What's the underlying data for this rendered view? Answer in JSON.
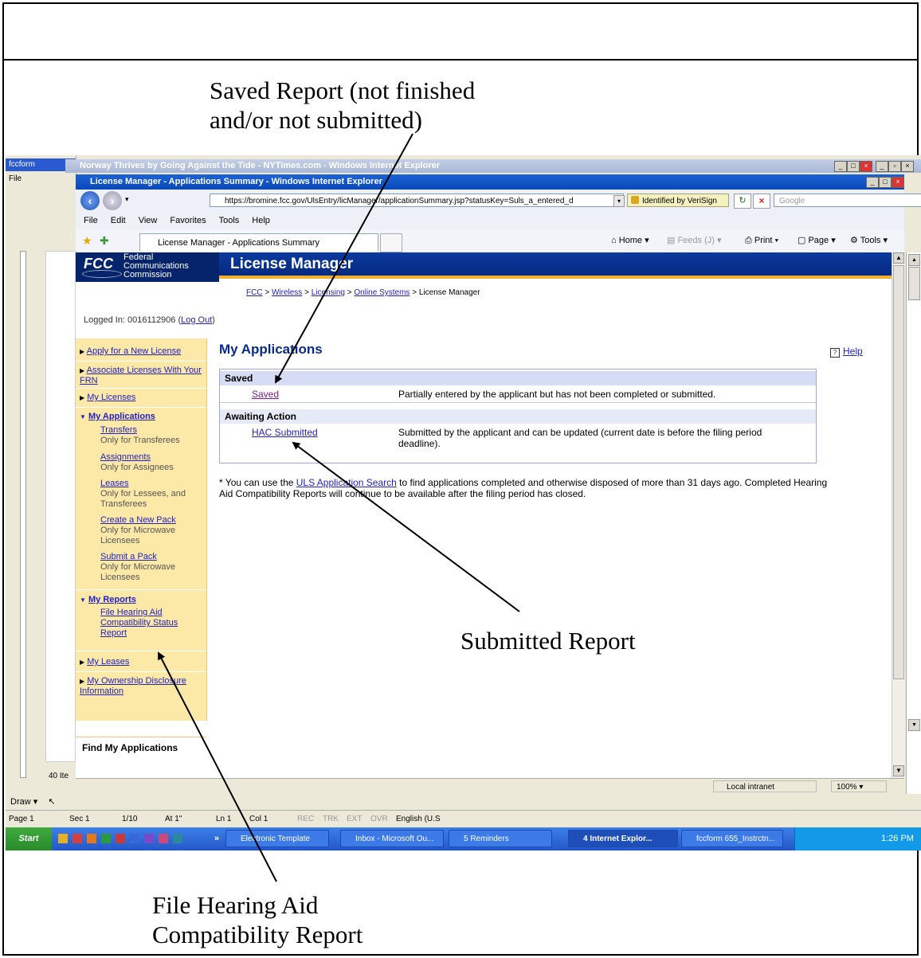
{
  "annotations": {
    "saved_report": "Saved Report (not finished\nand/or not submitted)",
    "submitted_report": "Submitted Report",
    "file_hac_report": "File Hearing Aid\nCompatibility Report"
  },
  "background_window": {
    "title": "Norway Thrives by Going Against the Tide - NYTimes.com - Windows Internet Explorer"
  },
  "browser": {
    "title": "License Manager - Applications Summary - Windows Internet Explorer",
    "url": "https://bromine.fcc.gov/UlsEntry/licManager/applicationSummary.jsp?statusKey=Suls_a_entered_d",
    "security": "Identified by VeriSign",
    "search_placeholder": "Google",
    "menu": [
      "File",
      "Edit",
      "View",
      "Favorites",
      "Tools",
      "Help"
    ],
    "tab_title": "License Manager - Applications Summary",
    "commands": {
      "home": "Home",
      "feeds": "Feeds (J)",
      "print": "Print",
      "page": "Page",
      "tools": "Tools"
    },
    "status": {
      "zone": "Local intranet",
      "zoom": "100%"
    }
  },
  "site": {
    "logo": "FCC",
    "agency_line1": "Federal",
    "agency_line2": "Communications",
    "agency_line3": "Commission",
    "app_title": "License Manager",
    "breadcrumb": {
      "fcc": "FCC",
      "wireless": "Wireless",
      "licensing": "Licensing",
      "online_systems": "Online Systems",
      "current": "License Manager",
      "sep": ">"
    },
    "logged_in_prefix": "Logged In: 0016112906 (",
    "logout": "Log Out",
    "logged_in_suffix": ")"
  },
  "sidebar": {
    "apply": "Apply for a New License",
    "associate": "Associate Licenses With Your FRN",
    "my_licenses": "My Licenses",
    "my_applications": "My Applications",
    "transfers": "Transfers",
    "transfers_desc": "Only for Transferees",
    "assignments": "Assignments",
    "assignments_desc": "Only for Assignees",
    "leases": "Leases",
    "leases_desc": "Only for Lessees, and Transferees",
    "create_pack": "Create a New Pack",
    "create_pack_desc": "Only for Microwave Licensees",
    "submit_pack": "Submit a Pack",
    "submit_pack_desc": "Only for Microwave Licensees",
    "my_reports": "My Reports",
    "file_hac": "File Hearing Aid Compatibility Status Report",
    "my_leases": "My Leases",
    "ownership": "My Ownership Disclosure Information",
    "find_apps": "Find My Applications"
  },
  "main": {
    "title": "My Applications",
    "help": "Help",
    "saved_heading": "Saved",
    "saved_link": "Saved",
    "saved_desc": "Partially entered by the applicant but has not been completed or submitted.",
    "awaiting_heading": "Awaiting Action",
    "hac_link": "HAC Submitted",
    "hac_desc": "Submitted by the applicant and can be updated (current date is before the filing period deadline).",
    "note_prefix": "* You can use the ",
    "note_link": "ULS Application Search",
    "note_suffix": " to find applications completed and otherwise disposed of more than 31 days ago. Completed Hearing Aid Compatibility Reports will continue to be available after the filing period has closed."
  },
  "word_status": {
    "page": "Page 1",
    "sec": "Sec 1",
    "pages": "1/10",
    "at": "At 1\"",
    "ln": "Ln 1",
    "col": "Col 1",
    "rec": "REC",
    "trk": "TRK",
    "ext": "EXT",
    "ovr": "OVR",
    "lang": "English (U.S",
    "draw": "Draw"
  },
  "taskbar": {
    "start": "Start",
    "tasks": [
      "Electronic Template",
      "Inbox - Microsoft Ou...",
      "5 Reminders",
      "4 Internet Explor...",
      "fccform 655_Instrctn..."
    ],
    "clock": "1:26 PM"
  },
  "left_app": {
    "title": "fccform",
    "items_count": "40 Ite"
  }
}
